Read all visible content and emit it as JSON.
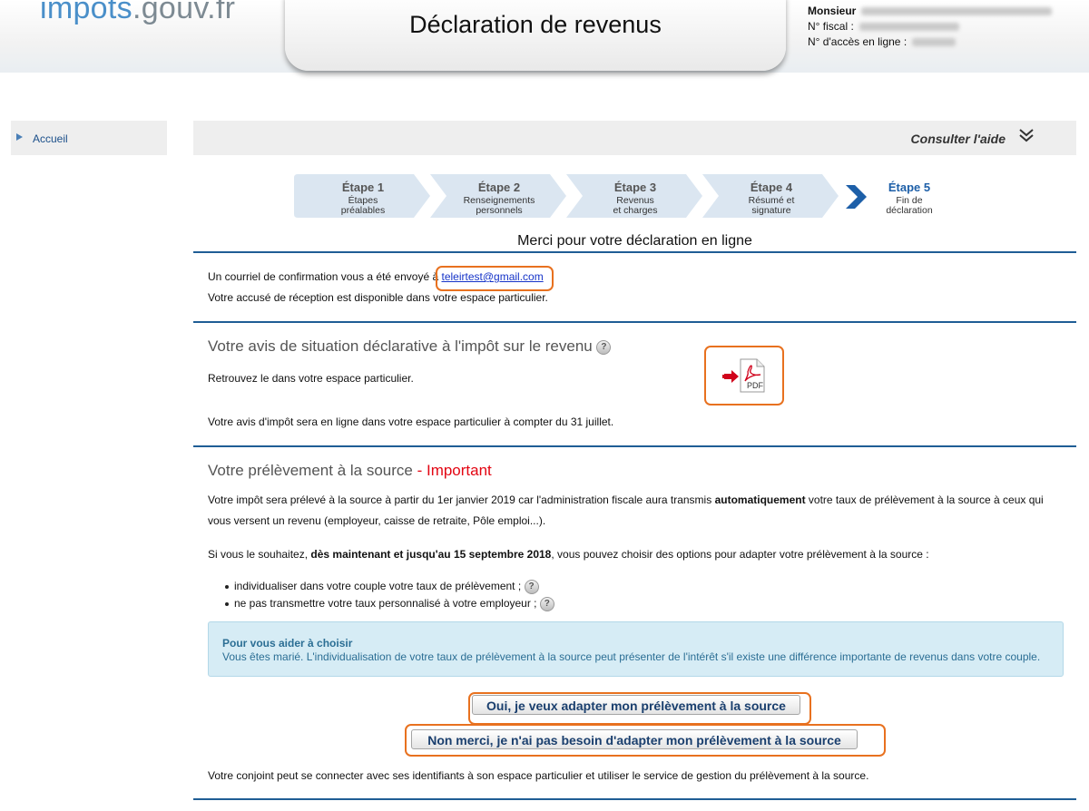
{
  "header": {
    "logo_main": "impots",
    "logo_tail": ".gouv.fr",
    "title": "Déclaration de revenus",
    "civility": "Monsieur",
    "fiscal_label": "N° fiscal :",
    "access_label": "N° d'accès en ligne :"
  },
  "sidebar": {
    "home_label": "Accueil"
  },
  "help": {
    "label": "Consulter l'aide"
  },
  "steps": [
    {
      "title": "Étape 1",
      "l1": "Étapes",
      "l2": "préalables"
    },
    {
      "title": "Étape 2",
      "l1": "Renseignements",
      "l2": "personnels"
    },
    {
      "title": "Étape 3",
      "l1": "Revenus",
      "l2": "et charges"
    },
    {
      "title": "Étape 4",
      "l1": "Résumé et",
      "l2": "signature"
    },
    {
      "title": "Étape 5",
      "l1": "Fin de",
      "l2": "déclaration"
    }
  ],
  "thanks": "Merci pour votre déclaration en ligne",
  "confirm": {
    "prefix": "Un courriel de confirmation vous a été envoyé à",
    "email": "teleirtest@gmail.com",
    "receipt": "Votre accusé de réception est disponible dans votre espace particulier."
  },
  "avis": {
    "title": "Votre avis de situation déclarative à l'impôt sur le revenu",
    "find": "Retrouvez le dans votre espace particulier.",
    "online": "Votre avis d'impôt sera en ligne dans votre espace particulier à compter du 31 juillet.",
    "pdf_label": "PDF"
  },
  "pas": {
    "title": "Votre prélèvement à la source",
    "important": " - Important",
    "p1_a": "Votre impôt sera prélevé à la source à partir du 1er janvier 2019 car l'administration fiscale aura transmis ",
    "p1_b": "automatiquement",
    "p1_c": " votre taux de prélèvement à la source à ceux qui",
    "p1_d": "vous versent un revenu (employeur, caisse de retraite, Pôle emploi...).",
    "p2_a": "Si vous le souhaitez, ",
    "p2_b": "dès maintenant et jusqu'au 15 septembre 2018",
    "p2_c": ", vous pouvez choisir des options pour adapter votre prélèvement à la source :",
    "bullet1": "individualiser dans votre couple votre taux de prélèvement ;",
    "bullet2": "ne pas transmettre votre taux personnalisé à votre employeur ;",
    "help_icon": "?"
  },
  "info": {
    "title": "Pour vous aider à choisir",
    "body": "Vous êtes marié. L'individualisation de votre taux de prélèvement à la source peut présenter de l'intérêt s'il existe une différence importante de revenus dans votre couple."
  },
  "buttons": {
    "yes": "Oui, je veux adapter mon prélèvement à la source",
    "no": "Non merci, je n'ai pas besoin d'adapter mon prélèvement à la source"
  },
  "spouse": "Votre conjoint peut se connecter avec ses identifiants à son espace particulier et utiliser le service de gestion du prélèvement à la source.",
  "colors": {
    "accent": "#1f5d95",
    "highlight": "#e8711f",
    "important": "#e30613"
  }
}
